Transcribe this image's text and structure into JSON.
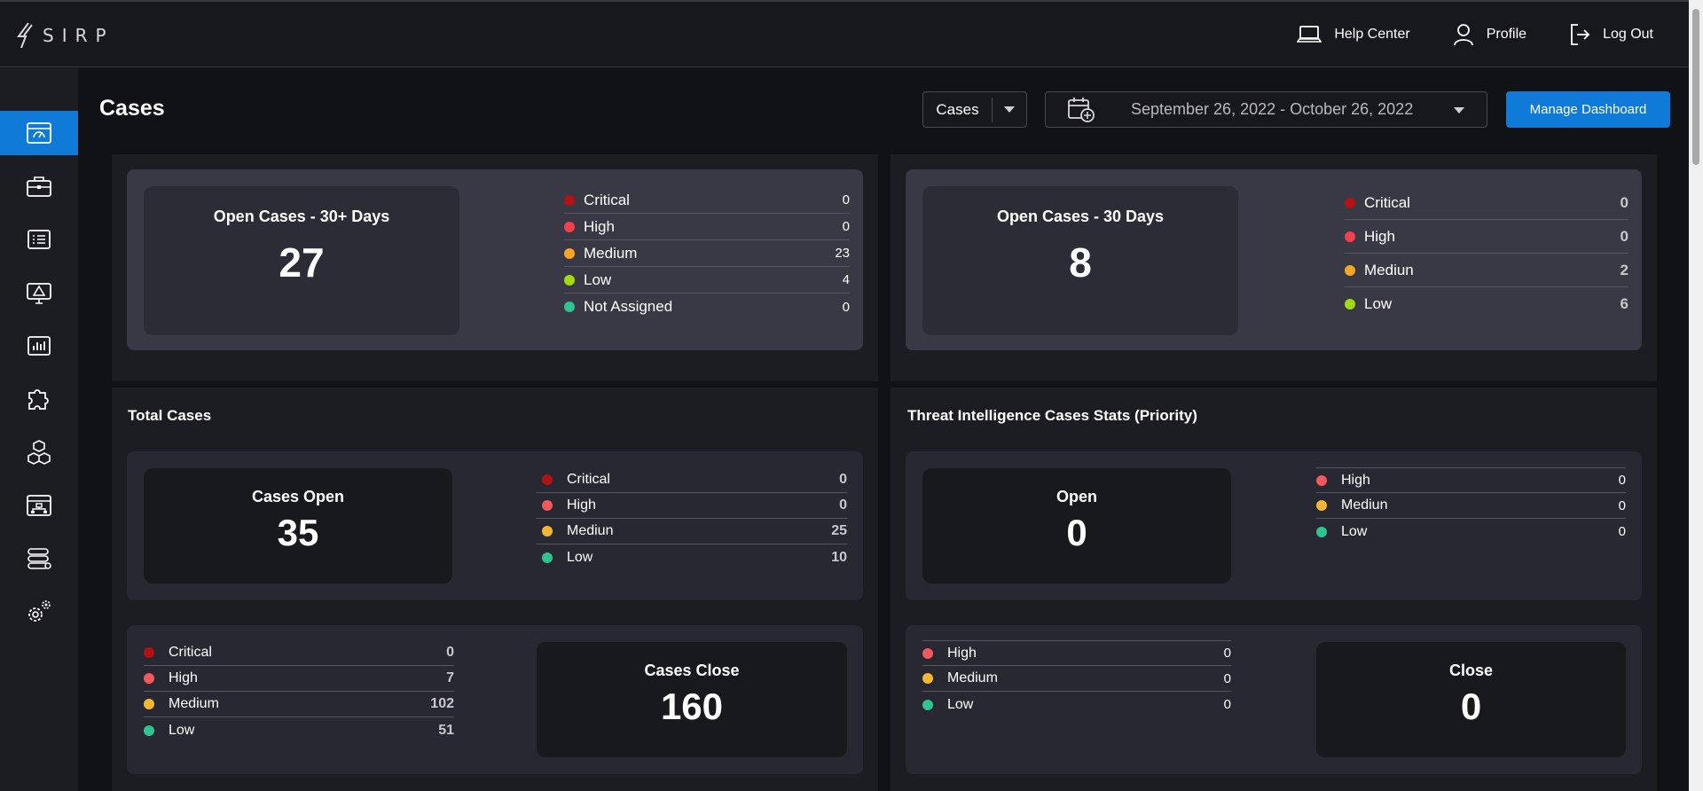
{
  "app": {
    "logo_text": "SIRP",
    "top_actions": [
      {
        "label": "Help Center",
        "icon": "laptop-icon"
      },
      {
        "label": "Profile",
        "icon": "user-icon"
      },
      {
        "label": "Log Out",
        "icon": "logout-icon"
      }
    ]
  },
  "sidebar": {
    "items": [
      {
        "icon": "dashboard-icon",
        "active": true
      },
      {
        "icon": "briefcase-icon"
      },
      {
        "icon": "list-icon"
      },
      {
        "icon": "monitor-alert-icon"
      },
      {
        "icon": "bar-chart-icon"
      },
      {
        "icon": "puzzle-icon"
      },
      {
        "icon": "cubes-icon"
      },
      {
        "icon": "org-chart-icon"
      },
      {
        "icon": "database-icon"
      },
      {
        "icon": "gears-icon"
      }
    ]
  },
  "header": {
    "title": "Cases",
    "select_value": "Cases",
    "date_range": "September 26, 2022 - October 26, 2022",
    "manage_button": "Manage Dashboard"
  },
  "colors": {
    "critical": "#b31212",
    "high": "#f2404f",
    "medium": "#f5a623",
    "low_lime": "#a4d80f",
    "low_green": "#2fc48f",
    "accent": "#0f7ad8"
  },
  "open30plus": {
    "title": "Open Cases - 30+ Days",
    "value": "27",
    "legend": [
      {
        "label": "Critical",
        "value": "0"
      },
      {
        "label": "High",
        "value": "0"
      },
      {
        "label": "Medium",
        "value": "23"
      },
      {
        "label": "Low",
        "value": "4"
      },
      {
        "label": "Not Assigned",
        "value": "0"
      }
    ]
  },
  "open30": {
    "title": "Open Cases - 30 Days",
    "value": "8",
    "legend": [
      {
        "label": "Critical",
        "value": "0"
      },
      {
        "label": "High",
        "value": "0"
      },
      {
        "label": "Mediun",
        "value": "2"
      },
      {
        "label": "Low",
        "value": "6"
      }
    ]
  },
  "total_cases": {
    "section_title": "Total Cases",
    "open": {
      "title": "Cases Open",
      "value": "35",
      "legend": [
        {
          "label": "Critical",
          "value": "0"
        },
        {
          "label": "High",
          "value": "0"
        },
        {
          "label": "Mediun",
          "value": "25"
        },
        {
          "label": "Low",
          "value": "10"
        }
      ]
    },
    "close": {
      "title": "Cases Close",
      "value": "160",
      "legend": [
        {
          "label": "Critical",
          "value": "0"
        },
        {
          "label": "High",
          "value": "7"
        },
        {
          "label": "Medium",
          "value": "102"
        },
        {
          "label": "Low",
          "value": "51"
        }
      ]
    }
  },
  "threat_intel": {
    "section_title": "Threat Intelligence Cases Stats (Priority)",
    "open": {
      "title": "Open",
      "value": "0",
      "legend": [
        {
          "label": "High",
          "value": "0"
        },
        {
          "label": "Mediun",
          "value": "0"
        },
        {
          "label": "Low",
          "value": "0"
        }
      ]
    },
    "close": {
      "title": "Close",
      "value": "0",
      "legend": [
        {
          "label": "High",
          "value": "0"
        },
        {
          "label": "Medium",
          "value": "0"
        },
        {
          "label": "Low",
          "value": "0"
        }
      ]
    }
  }
}
